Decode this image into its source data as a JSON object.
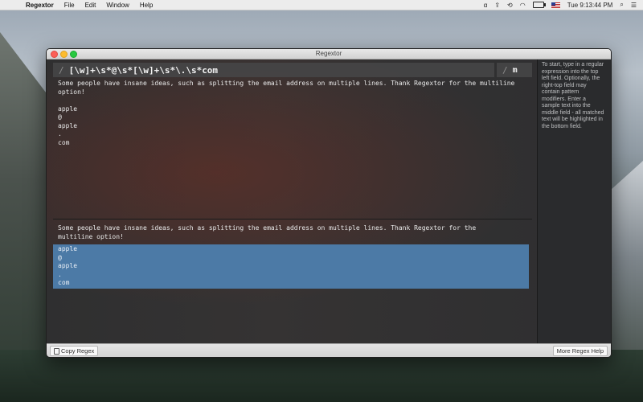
{
  "menubar": {
    "app_name": "Regextor",
    "items": [
      "File",
      "Edit",
      "Window",
      "Help"
    ],
    "clock": "Tue 9:13:44 PM"
  },
  "window": {
    "title": "Regextor"
  },
  "regex": {
    "pattern": "[\\w]+\\s*@\\s*[\\w]+\\s*\\.\\s*com",
    "modifiers": "m",
    "slash": "/"
  },
  "sample_text": "Some people have insane ideas, such as splitting the email address on multiple lines. Thank Regextor for the multiline option!\n\napple\n@\napple\n.\ncom",
  "result": {
    "intro": "Some people have insane ideas, such as splitting the email address on multiple lines. Thank Regextor for the multiline option!",
    "match": "apple\n@\napple\n.\ncom"
  },
  "help_text": "To start, type in a regular expression into the top left field. Optionally, the right-top field may contain pattern modifiers. Enter a sample text into the middle field - all matched text will be highlighted in the bottom field.",
  "buttons": {
    "copy_regex": "Copy Regex",
    "more_help": "More Regex Help"
  },
  "colors": {
    "highlight": "#4c7aa6"
  }
}
